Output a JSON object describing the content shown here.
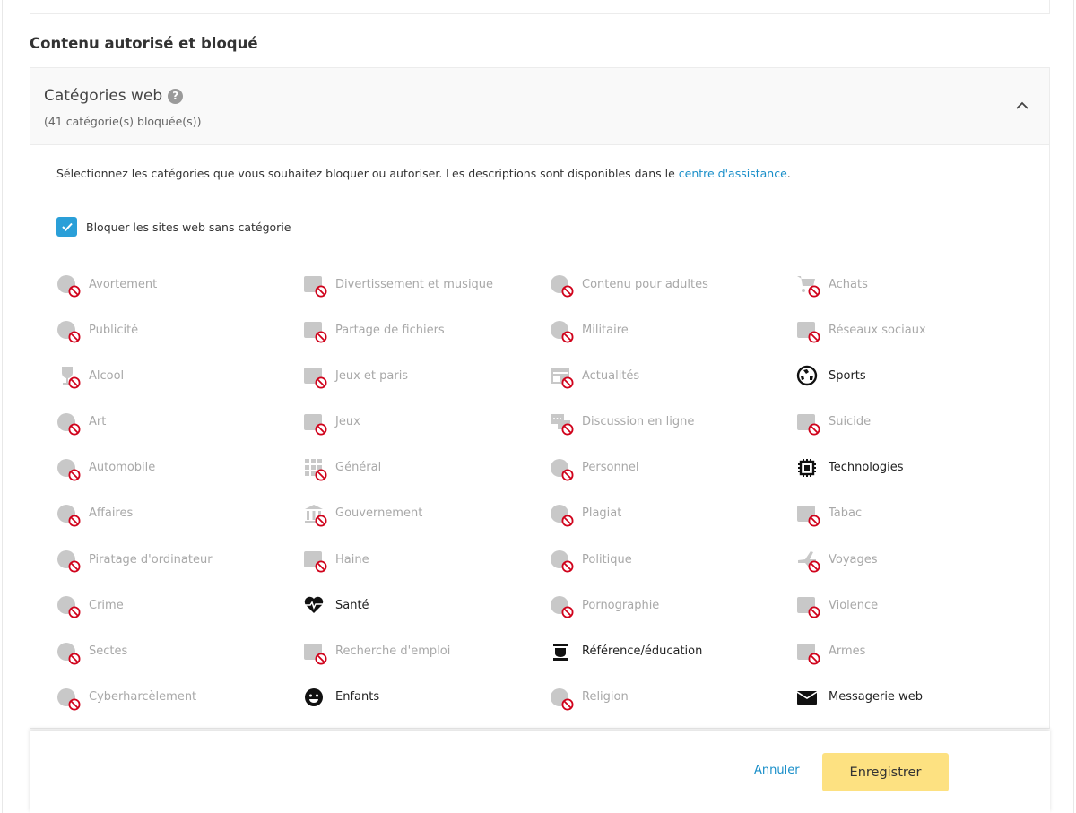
{
  "section": {
    "title": "Contenu autorisé et bloqué"
  },
  "web_categories": {
    "title": "Catégories web",
    "help_icon": "?",
    "subtitle": "(41 catégorie(s) bloquée(s))",
    "expanded": true,
    "description_prefix": "Sélectionnez les catégories que vous souhaitez bloquer ou autoriser. Les descriptions sont disponibles dans le ",
    "description_link": "centre d'assistance",
    "description_suffix": ".",
    "block_uncategorized": {
      "label": "Bloquer les sites web sans catégorie",
      "checked": true
    },
    "colors": {
      "accent": "#2a9fd8",
      "link": "#1a8fc9",
      "blocked_text": "#a8a8a8",
      "blocked_badge": "#d0021b",
      "save_button": "#fde181"
    },
    "categories": [
      {
        "label": "Avortement",
        "icon": "abortion-icon",
        "blocked": true
      },
      {
        "label": "Divertissement et musique",
        "icon": "music-icon",
        "blocked": true
      },
      {
        "label": "Contenu pour adultes",
        "icon": "adult-content-icon",
        "blocked": true
      },
      {
        "label": "Achats",
        "icon": "shopping-cart-icon",
        "blocked": true
      },
      {
        "label": "Publicité",
        "icon": "billboard-icon",
        "blocked": true
      },
      {
        "label": "Partage de fichiers",
        "icon": "file-share-icon",
        "blocked": true
      },
      {
        "label": "Militaire",
        "icon": "military-icon",
        "blocked": true
      },
      {
        "label": "Réseaux sociaux",
        "icon": "social-network-icon",
        "blocked": true
      },
      {
        "label": "Alcool",
        "icon": "wine-glass-icon",
        "blocked": true
      },
      {
        "label": "Jeux et paris",
        "icon": "gambling-icon",
        "blocked": true
      },
      {
        "label": "Actualités",
        "icon": "news-icon",
        "blocked": true
      },
      {
        "label": "Sports",
        "icon": "soccer-ball-icon",
        "blocked": false
      },
      {
        "label": "Art",
        "icon": "palette-icon",
        "blocked": true
      },
      {
        "label": "Jeux",
        "icon": "gamepad-icon",
        "blocked": true
      },
      {
        "label": "Discussion en ligne",
        "icon": "chat-icon",
        "blocked": true
      },
      {
        "label": "Suicide",
        "icon": "suicide-icon",
        "blocked": true
      },
      {
        "label": "Automobile",
        "icon": "car-icon",
        "blocked": true
      },
      {
        "label": "Général",
        "icon": "grid-icon",
        "blocked": true
      },
      {
        "label": "Personnel",
        "icon": "contact-book-icon",
        "blocked": true
      },
      {
        "label": "Technologies",
        "icon": "chip-icon",
        "blocked": false
      },
      {
        "label": "Affaires",
        "icon": "briefcase-icon",
        "blocked": true
      },
      {
        "label": "Gouvernement",
        "icon": "government-building-icon",
        "blocked": true
      },
      {
        "label": "Plagiat",
        "icon": "copyright-icon",
        "blocked": true
      },
      {
        "label": "Tabac",
        "icon": "cigarette-icon",
        "blocked": true
      },
      {
        "label": "Piratage d'ordinateur",
        "icon": "hacker-icon",
        "blocked": true
      },
      {
        "label": "Haine",
        "icon": "angry-face-icon",
        "blocked": true
      },
      {
        "label": "Politique",
        "icon": "podium-icon",
        "blocked": true
      },
      {
        "label": "Voyages",
        "icon": "airplane-icon",
        "blocked": true
      },
      {
        "label": "Crime",
        "icon": "police-badge-icon",
        "blocked": true
      },
      {
        "label": "Santé",
        "icon": "heartbeat-icon",
        "blocked": false
      },
      {
        "label": "Pornographie",
        "icon": "hearts-icon",
        "blocked": true
      },
      {
        "label": "Violence",
        "icon": "violence-face-icon",
        "blocked": true
      },
      {
        "label": "Sectes",
        "icon": "cult-icon",
        "blocked": true
      },
      {
        "label": "Recherche d'emploi",
        "icon": "job-search-icon",
        "blocked": true
      },
      {
        "label": "Référence/éducation",
        "icon": "graduation-icon",
        "blocked": false
      },
      {
        "label": "Armes",
        "icon": "weapons-icon",
        "blocked": true
      },
      {
        "label": "Cyberharcèlement",
        "icon": "cyberbullying-icon",
        "blocked": true
      },
      {
        "label": "Enfants",
        "icon": "child-face-icon",
        "blocked": false
      },
      {
        "label": "Religion",
        "icon": "praying-hands-icon",
        "blocked": true
      },
      {
        "label": "Messagerie web",
        "icon": "envelope-icon",
        "blocked": false
      }
    ]
  },
  "footer": {
    "cancel_label": "Annuler",
    "save_label": "Enregistrer"
  }
}
